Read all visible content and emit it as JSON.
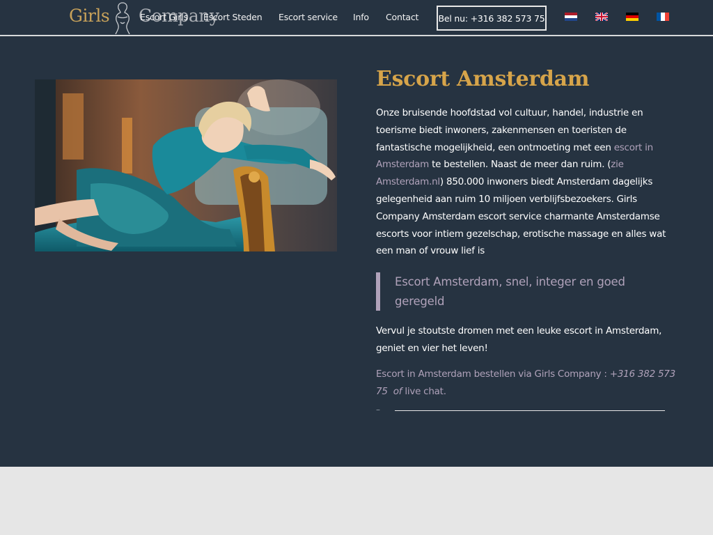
{
  "header": {
    "logo": {
      "left": "Girls",
      "right": "Company"
    },
    "nav": [
      {
        "label": "Escort Girls"
      },
      {
        "label": "Escort Steden"
      },
      {
        "label": "Escort service"
      },
      {
        "label": "Info"
      },
      {
        "label": "Contact"
      }
    ],
    "call_button": "Bel nu: +316 382 573 75",
    "languages": [
      "Nederlands",
      "English",
      "Deutsch",
      "Français"
    ]
  },
  "main": {
    "title": "Escort Amsterdam",
    "intro": {
      "p1": "Onze bruisende hoofdstad vol cultuur, handel, industrie en toerisme biedt inwoners, zakenmensen en toeristen de fantastische mogelijkheid, een ontmoeting met een ",
      "link1": "escort in Amsterdam",
      "p2": " te bestellen. Naast de meer dan ruim. (",
      "link2": "zie Amsterdam.nl",
      "p3": ") 850.000 inwoners biedt Amsterdam dagelijks gelegenheid aan ruim 10 miljoen verblijfsbezoekers. Girls Company Amsterdam escort service charmante Amsterdamse escorts voor intiem gezelschap, erotische massage en alles wat een man of vrouw lief is"
    },
    "quote": "Escort Amsterdam, snel, integer en goed geregeld",
    "para2": "Vervul je stoutste dromen met een leuke escort in Amsterdam, geniet en vier het leven!",
    "order": {
      "text": "Escort in Amsterdam bestellen via Girls Company : ",
      "phone": "+316 382 573 75",
      "of": "of",
      "chat": "live chat."
    },
    "dash": "–"
  },
  "colors": {
    "header_bg": "#263341",
    "main_bg": "#263341",
    "footer_bg": "#e6e6e6",
    "gold_accent": "#d6a44a",
    "lilac_link": "#b0a2ba"
  }
}
